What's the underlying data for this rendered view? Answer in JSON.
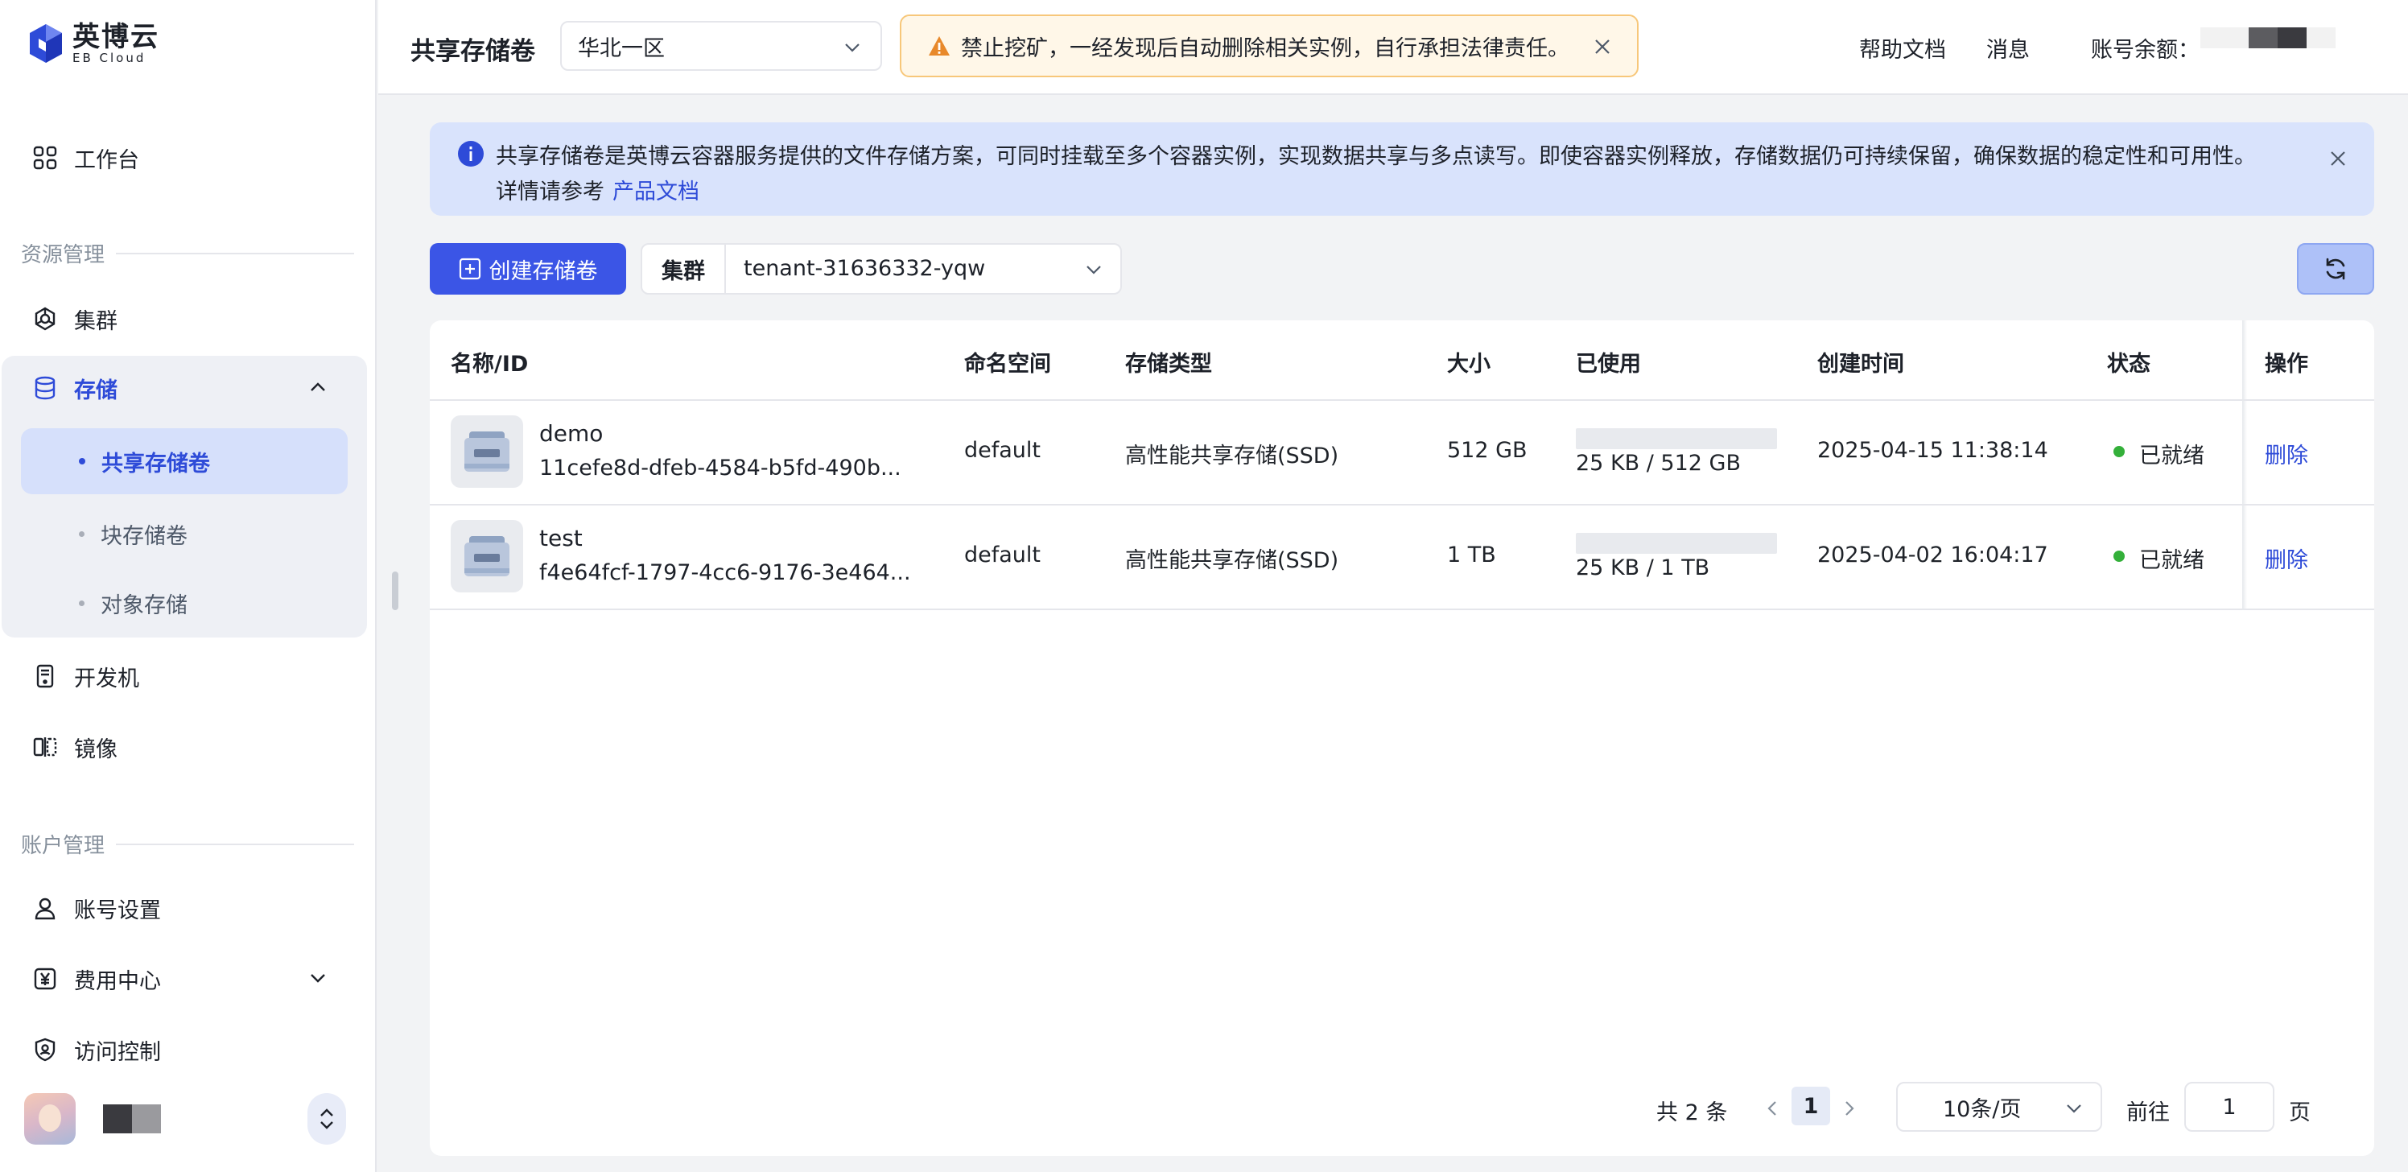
{
  "brand": {
    "name_cn": "英博云",
    "name_en": "EB Cloud"
  },
  "sidebar": {
    "workbench": "工作台",
    "section_resources": "资源管理",
    "cluster": "集群",
    "storage": {
      "label": "存储",
      "items": [
        {
          "label": "共享存储卷",
          "active": true
        },
        {
          "label": "块存储卷",
          "active": false
        },
        {
          "label": "对象存储",
          "active": false
        }
      ]
    },
    "devbox": "开发机",
    "images": "镜像",
    "section_account": "账户管理",
    "account_settings": "账号设置",
    "billing": "费用中心",
    "access_control": "访问控制",
    "masked_colors": [
      "#3a3a3f",
      "#9a9a9e"
    ]
  },
  "topbar": {
    "title": "共享存储卷",
    "region": "华北一区",
    "warning": "禁止挖矿，一经发现后自动删除相关实例，自行承担法律责任。",
    "help": "帮助文档",
    "messages": "消息",
    "balance_label": "账号余额：",
    "masked_colors": [
      "#f2f2f2",
      "#5c5c60",
      "#3a3a3f",
      "#f2f2f2"
    ]
  },
  "info": {
    "line1": "共享存储卷是英博云容器服务提供的文件存储方案，可同时挂载至多个容器实例，实现数据共享与多点读写。即使容器实例释放，存储数据仍可持续保留，确保数据的稳定性和可用性。",
    "line2_prefix": "详情请参考",
    "link": "产品文档"
  },
  "toolbar": {
    "create": "创建存储卷",
    "cluster_label": "集群",
    "cluster_value": "tenant-31636332-yqw"
  },
  "table": {
    "columns": [
      "名称/ID",
      "命名空间",
      "存储类型",
      "大小",
      "已使用",
      "创建时间",
      "状态",
      "操作"
    ],
    "rows": [
      {
        "name": "demo",
        "id": "11cefe8d-dfeb-4584-b5fd-490b...",
        "namespace": "default",
        "type": "高性能共享存储(SSD)",
        "size": "512 GB",
        "used": "25 KB / 512 GB",
        "used_fraction": 0.0,
        "created": "2025-04-15 11:38:14",
        "status": "已就绪",
        "action": "删除"
      },
      {
        "name": "test",
        "id": "f4e64fcf-1797-4cc6-9176-3e464...",
        "namespace": "default",
        "type": "高性能共享存储(SSD)",
        "size": "1 TB",
        "used": "25 KB / 1 TB",
        "used_fraction": 0.0,
        "created": "2025-04-02 16:04:17",
        "status": "已就绪",
        "action": "删除"
      }
    ]
  },
  "pagination": {
    "total": "共 2 条",
    "current_page": "1",
    "page_size": "10条/页",
    "goto_label": "前往",
    "goto_value": "1",
    "goto_unit": "页"
  },
  "colors": {
    "primary": "#3b55e6",
    "success": "#34b03a",
    "warning": "#e8892a"
  },
  "icons": {
    "workbench": "grid-icon",
    "cluster": "cluster-icon",
    "storage": "database-icon",
    "devbox": "server-icon",
    "images": "mirror-icon",
    "account": "user-icon",
    "billing": "yen-icon",
    "access": "shield-icon",
    "refresh": "refresh-icon",
    "warning": "warning-icon",
    "info": "info-icon"
  }
}
